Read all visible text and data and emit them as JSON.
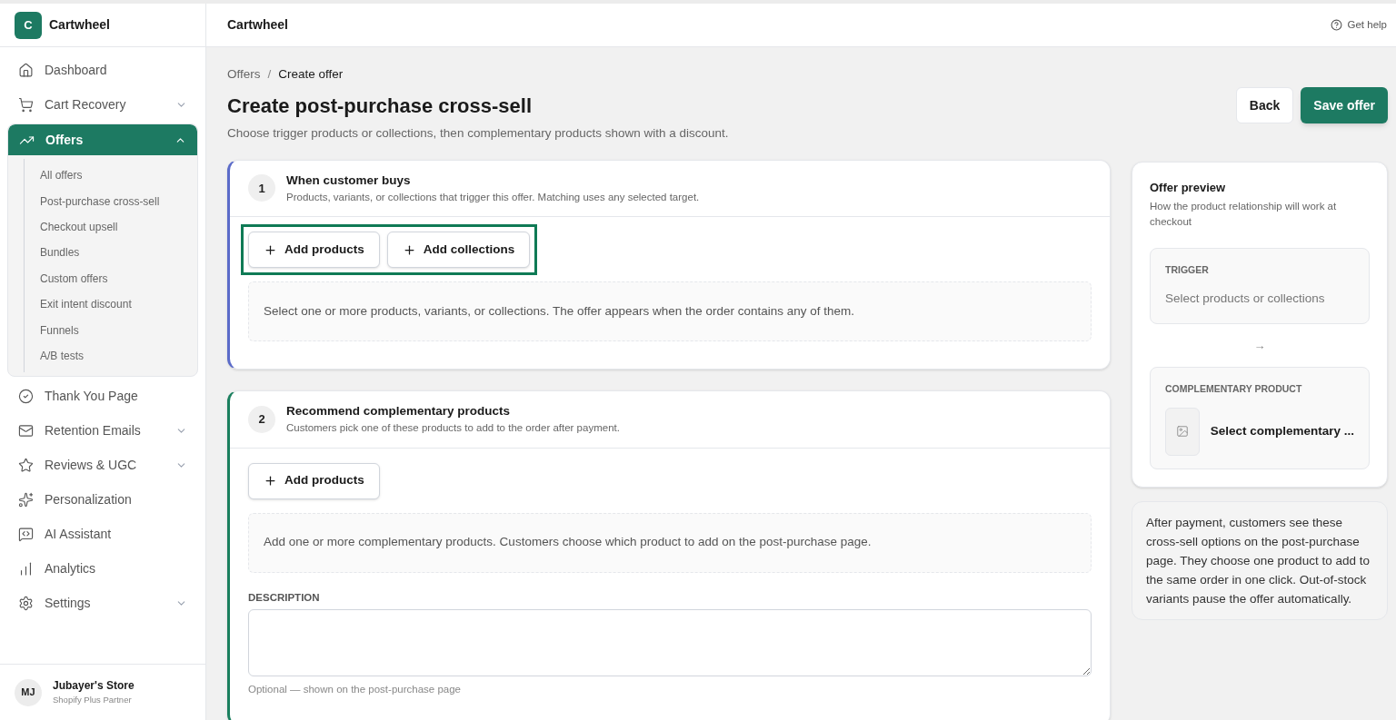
{
  "brand": {
    "logo_letter": "C",
    "name": "Cartwheel"
  },
  "sidebar": {
    "items": [
      {
        "label": "Dashboard",
        "selected": false
      },
      {
        "label": "Cart Recovery",
        "selected": false,
        "expanded": false
      },
      {
        "label": "Offers",
        "selected": true,
        "expanded": true,
        "children": [
          {
            "label": "All offers"
          },
          {
            "label": "Post-purchase cross-sell"
          },
          {
            "label": "Checkout upsell"
          },
          {
            "label": "Bundles"
          },
          {
            "label": "Custom offers"
          },
          {
            "label": "Exit intent discount"
          },
          {
            "label": "Funnels"
          },
          {
            "label": "A/B tests"
          }
        ]
      },
      {
        "label": "Thank You Page",
        "selected": false
      },
      {
        "label": "Retention Emails",
        "selected": false,
        "expanded": false
      },
      {
        "label": "Reviews & UGC",
        "selected": false,
        "expanded": false
      },
      {
        "label": "Personalization",
        "selected": false
      },
      {
        "label": "AI Assistant",
        "selected": false
      },
      {
        "label": "Analytics",
        "selected": false
      },
      {
        "label": "Settings",
        "selected": false,
        "expanded": false
      }
    ],
    "account": {
      "initials": "MJ",
      "name": "Jubayer's Store",
      "plan": "Shopify Plus Partner"
    }
  },
  "header": {
    "title": "Cartwheel",
    "help": "Get help"
  },
  "breadcrumb": [
    {
      "label": "Offers"
    },
    {
      "separator": "/",
      "label": "Create offer"
    }
  ],
  "page": {
    "title": "Create post-purchase cross-sell",
    "subtitle": "Choose trigger products or collections, then complementary products shown with a discount.",
    "buttons": [
      {
        "label": "Back",
        "kind": "secondary"
      },
      {
        "label": "Save offer",
        "kind": "primary"
      }
    ]
  },
  "sections": [
    {
      "number": "1",
      "title": "When customer buys",
      "subtitle": "Products, variants, or collections that trigger this offer. Matching uses any selected target.",
      "color": "#5b6bc9",
      "highlighted": true,
      "buttons": [
        "Add products",
        "Add collections"
      ],
      "empty_text": "Select one or more products, variants, or collections. The offer appears when the order contains any of them."
    },
    {
      "number": "2",
      "title": "Recommend complementary products",
      "subtitle": "Customers pick one of these products to add to the order after payment.",
      "color": "#1a7f5e",
      "buttons": [
        "Add products"
      ],
      "empty_text": "Add one or more complementary products. Customers choose which product to add on the post-purchase page.",
      "description": {
        "label": "DESCRIPTION",
        "hint": "Optional — shown on the post-purchase page"
      }
    }
  ],
  "preview": {
    "title": "Offer preview",
    "subtitle": "How the product relationship will work at checkout",
    "trigger": {
      "label": "TRIGGER",
      "value": "Select products or collections"
    },
    "arrow": "→",
    "product": {
      "label": "COMPLEMENTARY PRODUCT",
      "value": "Select complementary ..."
    }
  },
  "note": "After payment, customers see these cross-sell options on the post-purchase page. They choose one product to add to the same order in one click. Out-of-stock variants pause the offer automatically."
}
